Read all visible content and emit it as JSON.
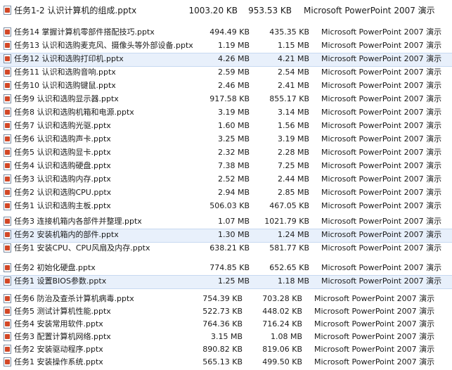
{
  "file_type_label": "Microsoft PowerPoint 2007 演示",
  "file_icon": "pptx-file-icon",
  "groups": [
    {
      "rows": [
        {
          "name": "任务1-2 认识计算机的组成.pptx",
          "size1": "1003.20 KB",
          "size2": "953.53 KB",
          "type": "Microsoft PowerPoint 2007 演示"
        }
      ]
    },
    {
      "rows": [
        {
          "name": "任务14 掌握计算机零部件搭配技巧.pptx",
          "size1": "494.49 KB",
          "size2": "435.35 KB",
          "type": "Microsoft PowerPoint 2007 演示"
        },
        {
          "name": "任务13 认识和选购麦克风、摄像头等外部设备.pptx",
          "size1": "1.19 MB",
          "size2": "1.15 MB",
          "type": "Microsoft PowerPoint 2007 演示"
        },
        {
          "name": "任务12 认识和选购打印机.pptx",
          "size1": "4.26 MB",
          "size2": "4.21 MB",
          "type": "Microsoft PowerPoint 2007 演示",
          "selected": true
        },
        {
          "name": "任务11 认识和选购音响.pptx",
          "size1": "2.59 MB",
          "size2": "2.54 MB",
          "type": "Microsoft PowerPoint 2007 演示"
        },
        {
          "name": "任务10 认识和选购键鼠.pptx",
          "size1": "2.46 MB",
          "size2": "2.41 MB",
          "type": "Microsoft PowerPoint 2007 演示"
        },
        {
          "name": "任务9 认识和选购显示器.pptx",
          "size1": "917.58 KB",
          "size2": "855.17 KB",
          "type": "Microsoft PowerPoint 2007 演示"
        },
        {
          "name": "任务8 认识和选购机箱和电源.pptx",
          "size1": "3.19 MB",
          "size2": "3.14 MB",
          "type": "Microsoft PowerPoint 2007 演示"
        },
        {
          "name": "任务7 认识和选购光驱.pptx",
          "size1": "1.60 MB",
          "size2": "1.56 MB",
          "type": "Microsoft PowerPoint 2007 演示"
        },
        {
          "name": "任务6 认识和选购声卡.pptx",
          "size1": "3.25 MB",
          "size2": "3.19 MB",
          "type": "Microsoft PowerPoint 2007 演示"
        },
        {
          "name": "任务5 认识和选购显卡.pptx",
          "size1": "2.32 MB",
          "size2": "2.28 MB",
          "type": "Microsoft PowerPoint 2007 演示"
        },
        {
          "name": "任务4 认识和选购硬盘.pptx",
          "size1": "7.38 MB",
          "size2": "7.25 MB",
          "type": "Microsoft PowerPoint 2007 演示"
        },
        {
          "name": "任务3 认识和选购内存.pptx",
          "size1": "2.52 MB",
          "size2": "2.44 MB",
          "type": "Microsoft PowerPoint 2007 演示"
        },
        {
          "name": "任务2 认识和选购CPU.pptx",
          "size1": "2.94 MB",
          "size2": "2.85 MB",
          "type": "Microsoft PowerPoint 2007 演示"
        },
        {
          "name": "任务1 认识和选购主板.pptx",
          "size1": "506.03 KB",
          "size2": "467.05 KB",
          "type": "Microsoft PowerPoint 2007 演示"
        }
      ]
    },
    {
      "rows": [
        {
          "name": "任务3 连接机箱内各部件并整理.pptx",
          "size1": "1.07 MB",
          "size2": "1021.79 KB",
          "type": "Microsoft PowerPoint 2007 演示"
        },
        {
          "name": "任务2 安装机箱内的部件.pptx",
          "size1": "1.30 MB",
          "size2": "1.24 MB",
          "type": "Microsoft PowerPoint 2007 演示",
          "selected": true
        },
        {
          "name": "任务1 安装CPU、CPU风扇及内存.pptx",
          "size1": "638.21 KB",
          "size2": "581.77 KB",
          "type": "Microsoft PowerPoint 2007 演示"
        }
      ]
    },
    {
      "rows": [
        {
          "name": "任务2 初始化硬盘.pptx",
          "size1": "774.85 KB",
          "size2": "652.65 KB",
          "type": "Microsoft PowerPoint 2007 演示"
        },
        {
          "name": "任务1 设置BIOS参数.pptx",
          "size1": "1.25 MB",
          "size2": "1.18 MB",
          "type": "Microsoft PowerPoint 2007 演示",
          "selected": true
        }
      ]
    },
    {
      "rows": [
        {
          "name": "任务6 防治及查杀计算机病毒.pptx",
          "size1": "754.39 KB",
          "size2": "703.28 KB",
          "type": "Microsoft PowerPoint 2007 演示"
        },
        {
          "name": "任务5 测试计算机性能.pptx",
          "size1": "522.73 KB",
          "size2": "448.02 KB",
          "type": "Microsoft PowerPoint 2007 演示"
        },
        {
          "name": "任务4 安装常用软件.pptx",
          "size1": "764.36 KB",
          "size2": "716.24 KB",
          "type": "Microsoft PowerPoint 2007 演示"
        },
        {
          "name": "任务3 配置计算机网络.pptx",
          "size1": "3.15 MB",
          "size2": "1.08 MB",
          "type": "Microsoft PowerPoint 2007 演示"
        },
        {
          "name": "任务2 安装驱动程序.pptx",
          "size1": "890.82 KB",
          "size2": "819.06 KB",
          "type": "Microsoft PowerPoint 2007 演示"
        },
        {
          "name": "任务1 安装操作系统.pptx",
          "size1": "565.13 KB",
          "size2": "499.50 KB",
          "type": "Microsoft PowerPoint 2007 演示"
        }
      ]
    }
  ]
}
